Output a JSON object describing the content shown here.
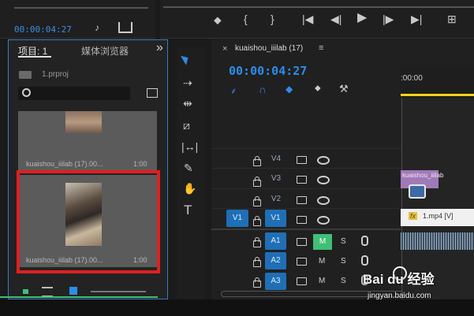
{
  "source_monitor": {
    "timecode": "00:00:04:27"
  },
  "project_panel": {
    "tab_project": "项目: 1",
    "tab_media_browser": "媒体浏览器",
    "more": "»",
    "project_file": "1.prproj",
    "search_placeholder": "",
    "items": [
      {
        "name": "kuaishou_iiilab (17).00...",
        "duration": "1:00"
      },
      {
        "name": "kuaishou_iiilab (17).00...",
        "duration": "1:00"
      }
    ]
  },
  "timeline": {
    "tab_title": "kuaishou_iiilab (17)",
    "timecode": "00:00:04:27",
    "ruler_start": ":00:00",
    "tracks": [
      {
        "id": "V4",
        "type": "video"
      },
      {
        "id": "V3",
        "type": "video"
      },
      {
        "id": "V2",
        "type": "video"
      },
      {
        "id": "V1",
        "type": "video",
        "source": "V1"
      },
      {
        "id": "A1",
        "type": "audio",
        "m": "M",
        "s": "S"
      },
      {
        "id": "A2",
        "type": "audio",
        "m": "M",
        "s": "S"
      },
      {
        "id": "A3",
        "type": "audio",
        "m": "M",
        "s": "S"
      }
    ],
    "clips": {
      "v2_clip": "kuaishou_iiilab",
      "v1_clip": "1.mp4 [V]",
      "fx": "fx"
    }
  },
  "watermark": {
    "logo": "Bai du 经验",
    "url": "jingyan.baidu.com"
  },
  "colors": {
    "accent_blue": "#2d8ceb",
    "selection_red": "#e02020",
    "clip_purple": "#a07ab8",
    "mute_green": "#3fbf75"
  }
}
